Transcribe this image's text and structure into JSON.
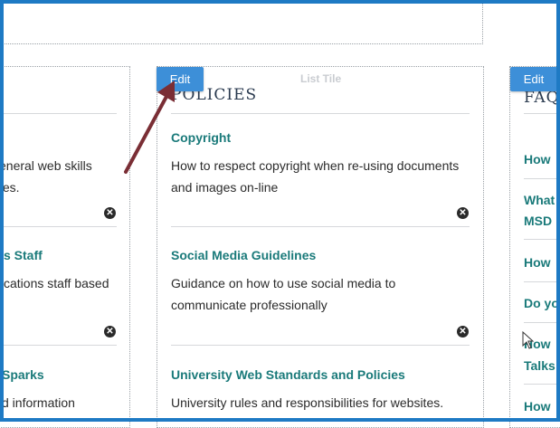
{
  "top_panel": {},
  "left_column": {
    "items": [
      {
        "title": "",
        "desc": "eneral web skills\ntes."
      },
      {
        "title": "s Staff",
        "desc": "cations staff based"
      },
      {
        "title": "Sparks",
        "desc": "d information"
      }
    ]
  },
  "middle_column": {
    "edit_label": "Edit",
    "tile_label": "List Tile",
    "heading": "POLICIES",
    "items": [
      {
        "title": "Copyright",
        "desc": "How to respect copyright when re-using documents and images on-line"
      },
      {
        "title": "Social Media Guidelines",
        "desc": "Guidance on how to use social media to communicate professionally"
      },
      {
        "title": "University Web Standards and Policies",
        "desc": "University rules and responsibilities for websites."
      }
    ]
  },
  "right_column": {
    "edit_label": "Edit",
    "heading": "FAQ",
    "links": [
      "How",
      "What",
      "MSD",
      "How",
      "Do yo",
      "How",
      "Talks",
      "How"
    ]
  },
  "colors": {
    "frame": "#1e7ac4",
    "edit_button": "#3d8fd8",
    "link": "#1a7a7a",
    "arrow": "#7a2e35"
  }
}
